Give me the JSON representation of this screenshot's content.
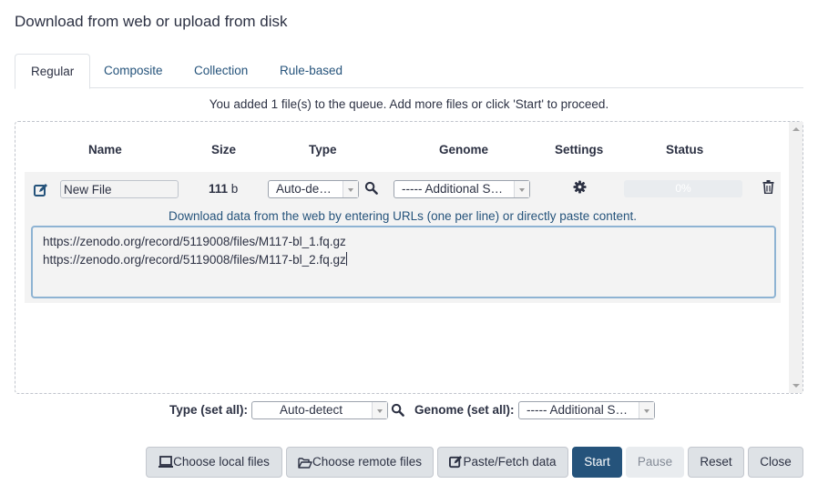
{
  "dialog": {
    "title": "Download from web or upload from disk"
  },
  "tabs": [
    {
      "label": "Regular",
      "active": true
    },
    {
      "label": "Composite",
      "active": false
    },
    {
      "label": "Collection",
      "active": false
    },
    {
      "label": "Rule-based",
      "active": false
    }
  ],
  "queue_message": "You added 1 file(s) to the queue. Add more files or click 'Start' to proceed.",
  "table": {
    "headers": {
      "name": "Name",
      "size": "Size",
      "type": "Type",
      "genome": "Genome",
      "settings": "Settings",
      "status": "Status"
    },
    "rows": [
      {
        "name": "New File",
        "size_value": "111",
        "size_unit": " b",
        "type": "Auto-de…",
        "genome": "----- Additional S…",
        "status": "0%",
        "progress_percent": 0,
        "hint": "Download data from the web by entering URLs (one per line) or directly paste content.",
        "content": "https://zenodo.org/record/5119008/files/M117-bl_1.fq.gz\nhttps://zenodo.org/record/5119008/files/M117-bl_2.fq.gz"
      }
    ]
  },
  "set_all": {
    "type_label": "Type (set all):",
    "type_value": "Auto-detect",
    "genome_label": "Genome (set all):",
    "genome_value": "----- Additional S…"
  },
  "buttons": {
    "choose_local": "Choose local files",
    "choose_remote": "Choose remote files",
    "paste_fetch": "Paste/Fetch data",
    "start": "Start",
    "pause": "Pause",
    "reset": "Reset",
    "close": "Close"
  },
  "colors": {
    "primary": "#25537b",
    "text": "#2c3143",
    "button_bg": "#dee2e6"
  }
}
